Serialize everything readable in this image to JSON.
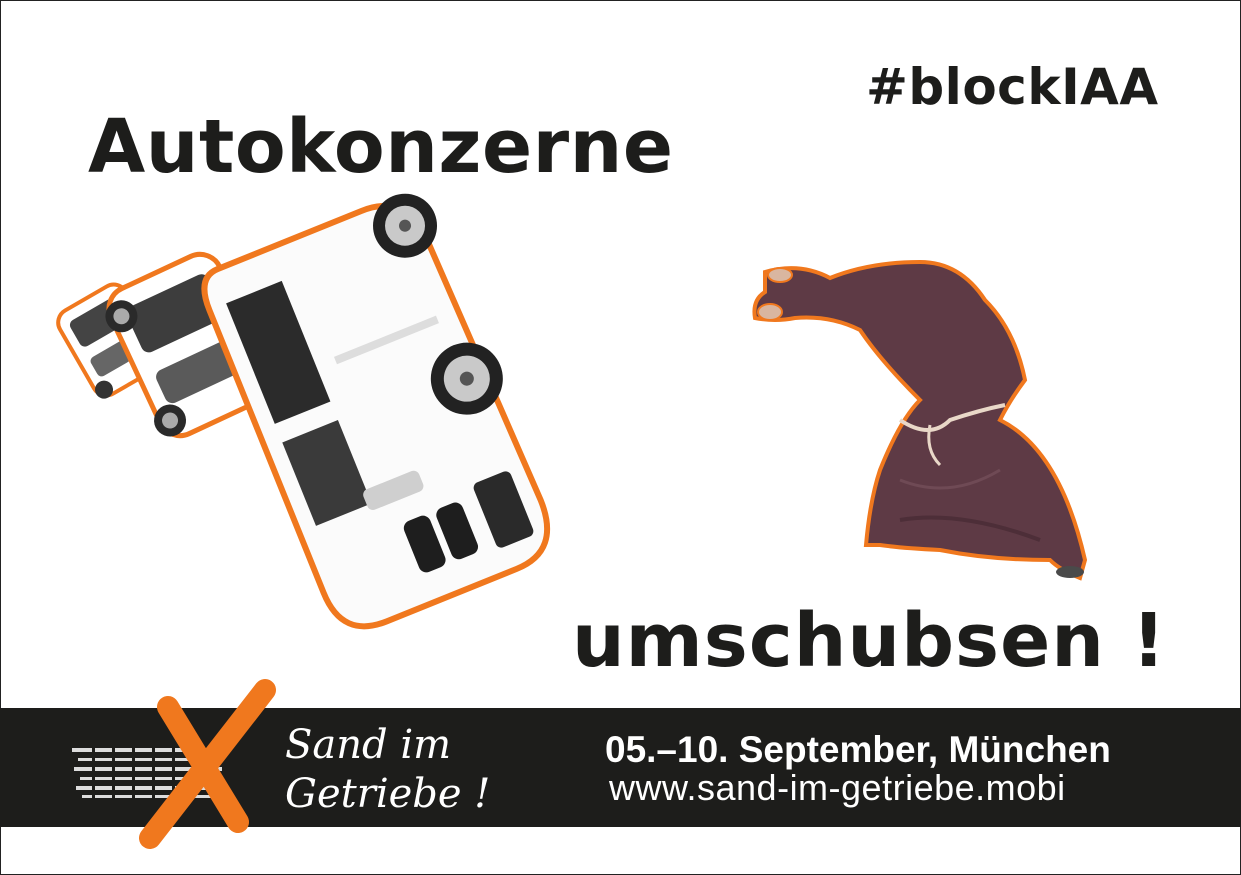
{
  "hashtag": "#blockIAA",
  "headline": "Autokonzerne",
  "tagline": "umschubsen !",
  "logo": {
    "line1": "Sand im",
    "line2": "Getriebe !",
    "mark_icon": "orange-x-icon",
    "tracks_icon": "tire-tracks-icon"
  },
  "event": {
    "date": "05.–10. September, München",
    "url": "www.sand-im-getriebe.mobi"
  },
  "colors": {
    "accent": "#f0781e",
    "band": "#1d1d1b",
    "text": "#1d1d1b",
    "robe": "#5e3a45"
  }
}
